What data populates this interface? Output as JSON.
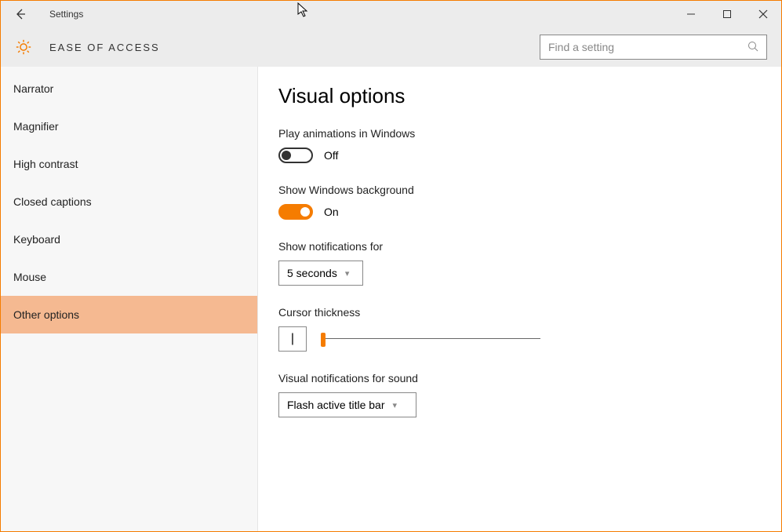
{
  "window": {
    "app_title": "Settings",
    "section_title": "EASE OF ACCESS"
  },
  "search": {
    "placeholder": "Find a setting"
  },
  "sidebar": {
    "items": [
      {
        "label": "Narrator"
      },
      {
        "label": "Magnifier"
      },
      {
        "label": "High contrast"
      },
      {
        "label": "Closed captions"
      },
      {
        "label": "Keyboard"
      },
      {
        "label": "Mouse"
      },
      {
        "label": "Other options"
      }
    ],
    "active_index": 6
  },
  "content": {
    "heading": "Visual options",
    "animations": {
      "label": "Play animations in Windows",
      "state": "Off",
      "on": false
    },
    "background": {
      "label": "Show Windows background",
      "state": "On",
      "on": true
    },
    "notifications": {
      "label": "Show notifications for",
      "value": "5 seconds"
    },
    "cursor": {
      "label": "Cursor thickness",
      "preview": "|"
    },
    "visual_notif": {
      "label": "Visual notifications for sound",
      "value": "Flash active title bar"
    }
  }
}
